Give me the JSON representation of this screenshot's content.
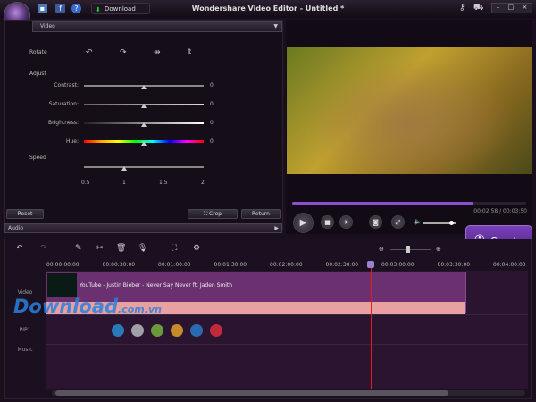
{
  "titlebar": {
    "title": "Wondershare Video Editor - Untitled *",
    "download_label": "Download",
    "icons": [
      "save-icon",
      "facebook-icon",
      "help-icon",
      "key-icon",
      "cart-icon",
      "minimize-icon",
      "maximize-icon",
      "close-icon"
    ]
  },
  "edit_panel": {
    "section": "Video",
    "rotate_label": "Rotate",
    "adjust_label": "Adjust",
    "adjust": [
      {
        "label": "Contrast:",
        "value": "0"
      },
      {
        "label": "Saturation:",
        "value": "0"
      },
      {
        "label": "Brightness:",
        "value": "0"
      },
      {
        "label": "Hue:",
        "value": "0"
      }
    ],
    "speed_label": "Speed",
    "speed_ticks": [
      "0.5",
      "1",
      "1.5",
      "2"
    ],
    "speed_value": 1,
    "reset_label": "Reset",
    "crop_label": "Crop",
    "return_label": "Return",
    "audio_label": "Audio"
  },
  "player": {
    "time": "00:02:58 / 00:03:50",
    "progress": 0.774,
    "volume": 0.85
  },
  "create_label": "Create",
  "timeline": {
    "ruler": [
      "00:00:00:00",
      "00:00:30:00",
      "00:01:00:00",
      "00:01:30:00",
      "00:02:00:00",
      "00:02:30:00",
      "00:03:00:00",
      "00:03:30:00",
      "00:04:00:00"
    ],
    "tracks": [
      "Video",
      "PIP1",
      "Music"
    ],
    "clip_title": "YouTube - Justin Bieber - Never Say Never ft. Jaden Smith",
    "pip_colors": [
      "#2a7ab8",
      "#a0a0a8",
      "#6a9a3a",
      "#c88a2a",
      "#2a6ab0",
      "#c02a3a"
    ]
  },
  "watermark": "Download.com.vn"
}
